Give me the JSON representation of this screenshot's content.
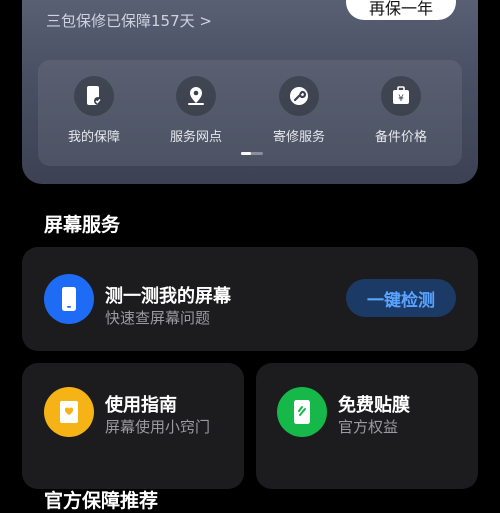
{
  "warranty": {
    "status_text": "三包保修已保障157天 >",
    "renew_label": "再保一年"
  },
  "services": [
    {
      "label": "我的保障",
      "icon": "phone-shield-icon"
    },
    {
      "label": "服务网点",
      "icon": "location-pin-icon"
    },
    {
      "label": "寄修服务",
      "icon": "wrench-icon"
    },
    {
      "label": "备件价格",
      "icon": "price-box-icon"
    }
  ],
  "screen_section": {
    "title": "屏幕服务",
    "main_card": {
      "title": "测一测我的屏幕",
      "subtitle": "快速查屏幕问题",
      "button": "一键检测",
      "icon": "phone-icon",
      "icon_color": "#1e6cf5"
    },
    "guide_card": {
      "title": "使用指南",
      "subtitle": "屏幕使用小窍门",
      "icon": "guide-book-icon",
      "icon_color": "#f5b316"
    },
    "film_card": {
      "title": "免费贴膜",
      "subtitle": "官方权益",
      "icon": "screen-film-icon",
      "icon_color": "#16b84a"
    }
  },
  "next_section": {
    "title": "官方保障推荐"
  }
}
